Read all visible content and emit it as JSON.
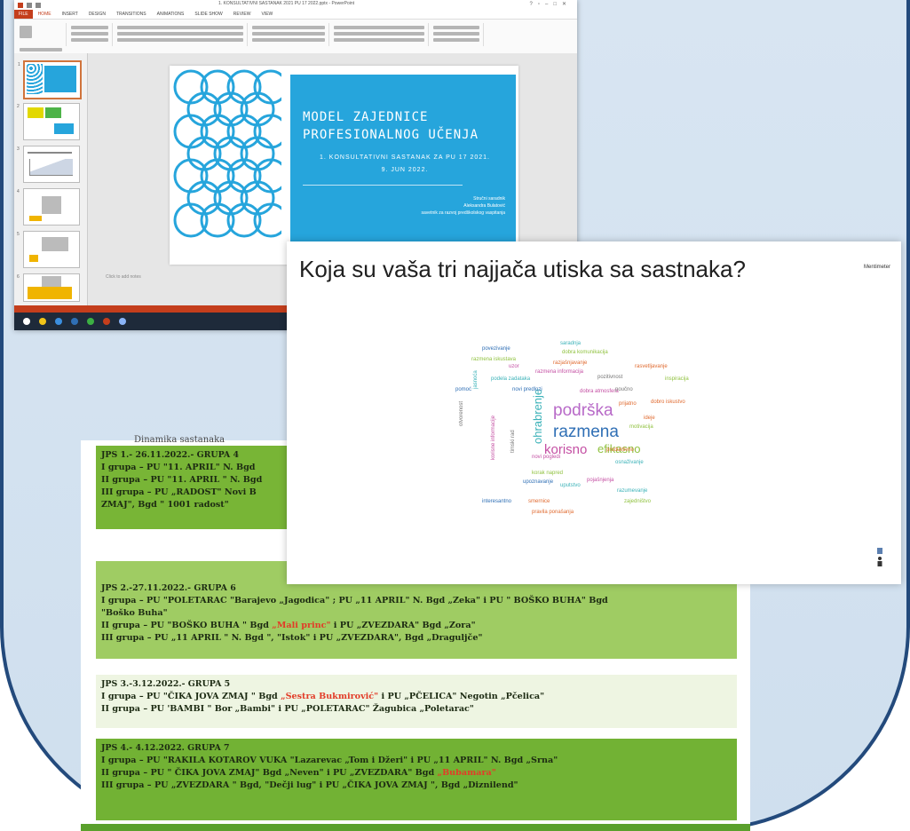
{
  "powerpoint": {
    "window_title": "1. KONSULTATIVNI SASTANAK 2021 PU 17 2022.pptx - PowerPoint",
    "tabs": [
      "FILE",
      "HOME",
      "INSERT",
      "DESIGN",
      "TRANSITIONS",
      "ANIMATIONS",
      "SLIDE SHOW",
      "REVIEW",
      "VIEW"
    ],
    "notes_placeholder": "Click to add notes",
    "slide": {
      "title_line1": "MODEL ZAJEDNICE",
      "title_line2": "PROFESIONALNOG UČENJA",
      "subtitle": "1. KONSULTATIVNI SASTANAK ZA PU 17 2021.",
      "date": "9. JUN 2022.",
      "author_role": "Stručni saradnik",
      "author_name": "Aleksandra Bulatović",
      "author_title": "savetnik za razvoj predškolskog vaspitanja"
    },
    "thumbnail_numbers": [
      "1",
      "2",
      "3",
      "4",
      "5",
      "6"
    ]
  },
  "menti": {
    "question": "Koja su vaša tri najjača utiska sa sastnaka?",
    "logo": "Mentimeter",
    "words": [
      {
        "text": "podrška",
        "color": "#b86ac8"
      },
      {
        "text": "razmena",
        "color": "#2f6fb5"
      },
      {
        "text": "korisno",
        "color": "#c44fa3"
      },
      {
        "text": "efikasno",
        "color": "#8fc13e"
      },
      {
        "text": "ohrabrenje",
        "color": "#3bb2b8"
      },
      {
        "text": "povezivanje",
        "color": "#2f6fb5"
      },
      {
        "text": "razmena informacija",
        "color": "#c44fa3"
      },
      {
        "text": "razmena iskustava",
        "color": "#8fc13e"
      },
      {
        "text": "rasvetljavanje",
        "color": "#e06a2f"
      },
      {
        "text": "pozitivnost",
        "color": "#777777"
      },
      {
        "text": "saradnja",
        "color": "#3bb2b8"
      },
      {
        "text": "razjašnjavanje",
        "color": "#e06a2f"
      },
      {
        "text": "uzor",
        "color": "#c44fa3"
      },
      {
        "text": "dobra komunikacija",
        "color": "#8fc13e"
      },
      {
        "text": "podela zadataka",
        "color": "#3bb2b8"
      },
      {
        "text": "pomoć",
        "color": "#2f6fb5"
      },
      {
        "text": "inspiracija",
        "color": "#8fc13e"
      },
      {
        "text": "dobro iskustvo",
        "color": "#e06a2f"
      },
      {
        "text": "dobra atmosfera",
        "color": "#c44fa3"
      },
      {
        "text": "jasnoća",
        "color": "#3bb2b8"
      },
      {
        "text": "otvorenost",
        "color": "#777777"
      },
      {
        "text": "poučno",
        "color": "#777777"
      },
      {
        "text": "prijatno",
        "color": "#e06a2f"
      },
      {
        "text": "novi predlozi",
        "color": "#2f6fb5"
      },
      {
        "text": "korak napred",
        "color": "#8fc13e"
      },
      {
        "text": "pojašnjenja",
        "color": "#c44fa3"
      },
      {
        "text": "uputstvo",
        "color": "#3bb2b8"
      },
      {
        "text": "motivacija",
        "color": "#8fc13e"
      },
      {
        "text": "interesantno",
        "color": "#2f6fb5"
      },
      {
        "text": "smernice",
        "color": "#e06a2f"
      },
      {
        "text": "korisne informacije",
        "color": "#c44fa3"
      },
      {
        "text": "razumevanje",
        "color": "#3bb2b8"
      },
      {
        "text": "produktivno",
        "color": "#e06a2f"
      },
      {
        "text": "zajedništvo",
        "color": "#8fc13e"
      },
      {
        "text": "novi pogledi",
        "color": "#c44fa3"
      },
      {
        "text": "osnaživanje",
        "color": "#3bb2b8"
      },
      {
        "text": "upoznavanje",
        "color": "#2f6fb5"
      },
      {
        "text": "timski rad",
        "color": "#777777"
      },
      {
        "text": "ideje",
        "color": "#e06a2f"
      },
      {
        "text": "pravila ponašanja",
        "color": "#e06a2f"
      }
    ]
  },
  "schedule": {
    "cut_heading": "Dinamika sastanaka",
    "blocks": [
      {
        "lines": [
          "JPS 1.- 26.11.2022.- GRUPA 4",
          "I grupa – PU \"11. APRIL\" N. Bgd",
          "II grupa – PU \"11. APRIL \" N. Bgd",
          "III grupa – PU „RADOST\" Novi B",
          "ZMAJ\", Bgd \" 1001 radost\""
        ]
      },
      {
        "lines": [
          "JPS 2.-27.11.2022.- GRUPA 6",
          "I grupa – PU \"POLETARAC \"Barajevo „Jagodica\" ; PU „11 APRIL\" N. Bgd „Zeka\" i PU \" BOŠKO BUHA\" Bgd",
          "\"Boško Buha\""
        ],
        "line4_pre": "II grupa – PU \"BOŠKO BUHA \" Bgd ",
        "line4_hl": "„Mali princ\"",
        "line4_post": " i PU „ZVEZDARA\" Bgd   „Zora\"",
        "line5": "III grupa – PU „11 APRIL \" N. Bgd \", \"Istok\" i PU „ZVEZDARA\", Bgd   „Draguljče\""
      },
      {
        "line1": "JPS 3.-3.12.2022.- GRUPA 5",
        "line2_pre": "I grupa – PU \"ČIKA JOVA ZMAJ \" Bgd ",
        "line2_hl": "„Sestra Bukmirović\"",
        "line2_post": " i PU „PČELICA\" Negotin  „Pčelica\"",
        "line3": "II grupa – PU 'BAMBI \" Bor „Bambi\" i PU „POLETARAC\" Žagubica  „Poletarac\""
      },
      {
        "line1": "JPS 4.- 4.12.2022. GRUPA 7",
        "line2": "I grupa –  PU \"RAKILA KOTAROV VUKA \"Lazarevac „Tom i Džeri\" i   PU „11 APRIL\" N. Bgd  „Srna\"",
        "line3_pre": "II grupa –  PU \" ČIKA JOVA ZMAJ\" Bgd „Neven\" i PU „ZVEZDARA\" Bgd   ",
        "line3_hl": "„Bubamara\"",
        "line4": "III grupa – PU „ZVEZDARA \"  Bgd, \"Dečji lug\" i PU „ČIKA JOVA ZMAJ \", Bgd   „Diznilend\""
      }
    ]
  },
  "colors": {
    "frame_border": "#234a7c",
    "background": "#d8e5f2",
    "slide_blue": "#26a5dc",
    "ppt_accent": "#c43e1c",
    "green_dark": "#78b536",
    "green_light": "#9fcc63",
    "highlight_red": "#e23c28"
  }
}
